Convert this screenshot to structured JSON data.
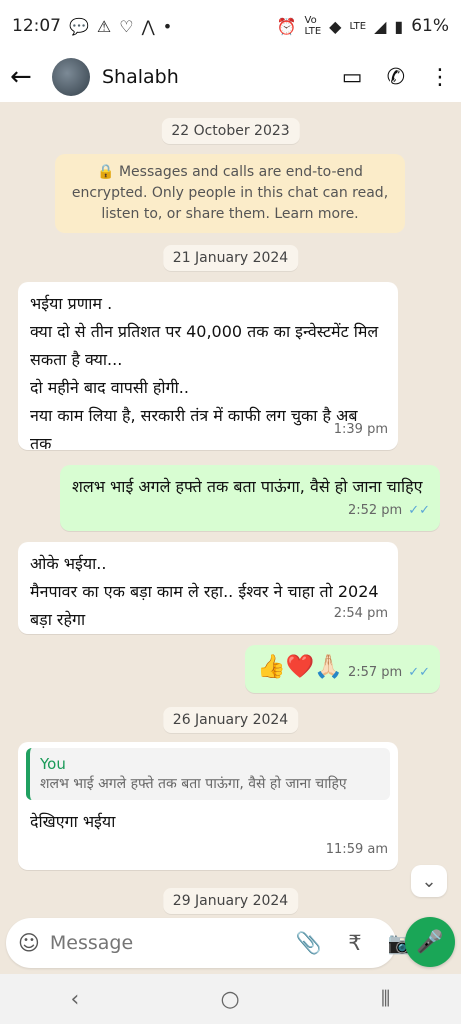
{
  "status_bar": {
    "time": "12:07",
    "left_icons": [
      "chat-bubble-icon",
      "warning-icon",
      "heart-chat-icon",
      "a-logo-icon",
      "dot-icon"
    ],
    "right_icons": [
      "alarm-icon",
      "volte-icon",
      "wifi-icon",
      "lte-icon",
      "signal-icon",
      "battery-icon"
    ],
    "battery": "61%"
  },
  "app_bar": {
    "contact_name": "Shalabh",
    "icons": [
      "back-arrow-icon",
      "video-call-icon",
      "phone-call-icon",
      "more-vertical-icon"
    ]
  },
  "chat": {
    "date_1": "22 October 2023",
    "encryption_notice": "Messages and calls are end-to-end encrypted. Only people in this chat can read, listen to, or share them. Learn more.",
    "date_2": "21 January 2024",
    "msg1": {
      "text": "भईया प्रणाम .\nक्या दो से तीन प्रतिशत पर 40,000 तक का इन्वेस्टमेंट मिल सकता है क्या...\nदो महीने बाद वापसी होगी..\nनया काम लिया है, सरकारी तंत्र में काफी लग चुका है अब तक",
      "time": "1:39 pm"
    },
    "msg2": {
      "text": "शलभ भाई अगले हफ्ते तक बता पाऊंगा, वैसे हो जाना चाहिए",
      "time": "2:52 pm"
    },
    "msg3": {
      "text": "ओके भईया..\nमैनपावर का एक बड़ा काम ले रहा.. ईश्वर ने चाहा तो 2024 बड़ा रहेगा",
      "time": "2:54 pm"
    },
    "msg4": {
      "text": "👍❤️🙏🏻",
      "time": "2:57 pm"
    },
    "date_3": "26 January 2024",
    "msg5": {
      "quote_name": "You",
      "quote_text": "शलभ भाई अगले हफ्ते तक बता पाऊंगा, वैसे हो जाना चाहिए",
      "text": "देखिएगा भईया",
      "time": "11:59 am"
    },
    "date_4": "29 January 2024"
  },
  "composer": {
    "placeholder": "Message",
    "icons": [
      "emoji-sticker-icon",
      "attach-icon",
      "rupee-payment-icon",
      "camera-icon",
      "mic-icon"
    ]
  },
  "nav_bar": {
    "icons": [
      "back-nav-icon",
      "home-nav-icon",
      "recents-nav-icon"
    ]
  },
  "colors": {
    "chat_bg": "#efe7dc",
    "incoming_bubble": "#ffffff",
    "outgoing_bubble": "#d8fdd2",
    "accent_green": "#1aa657",
    "read_ticks": "#5aa6d6"
  }
}
